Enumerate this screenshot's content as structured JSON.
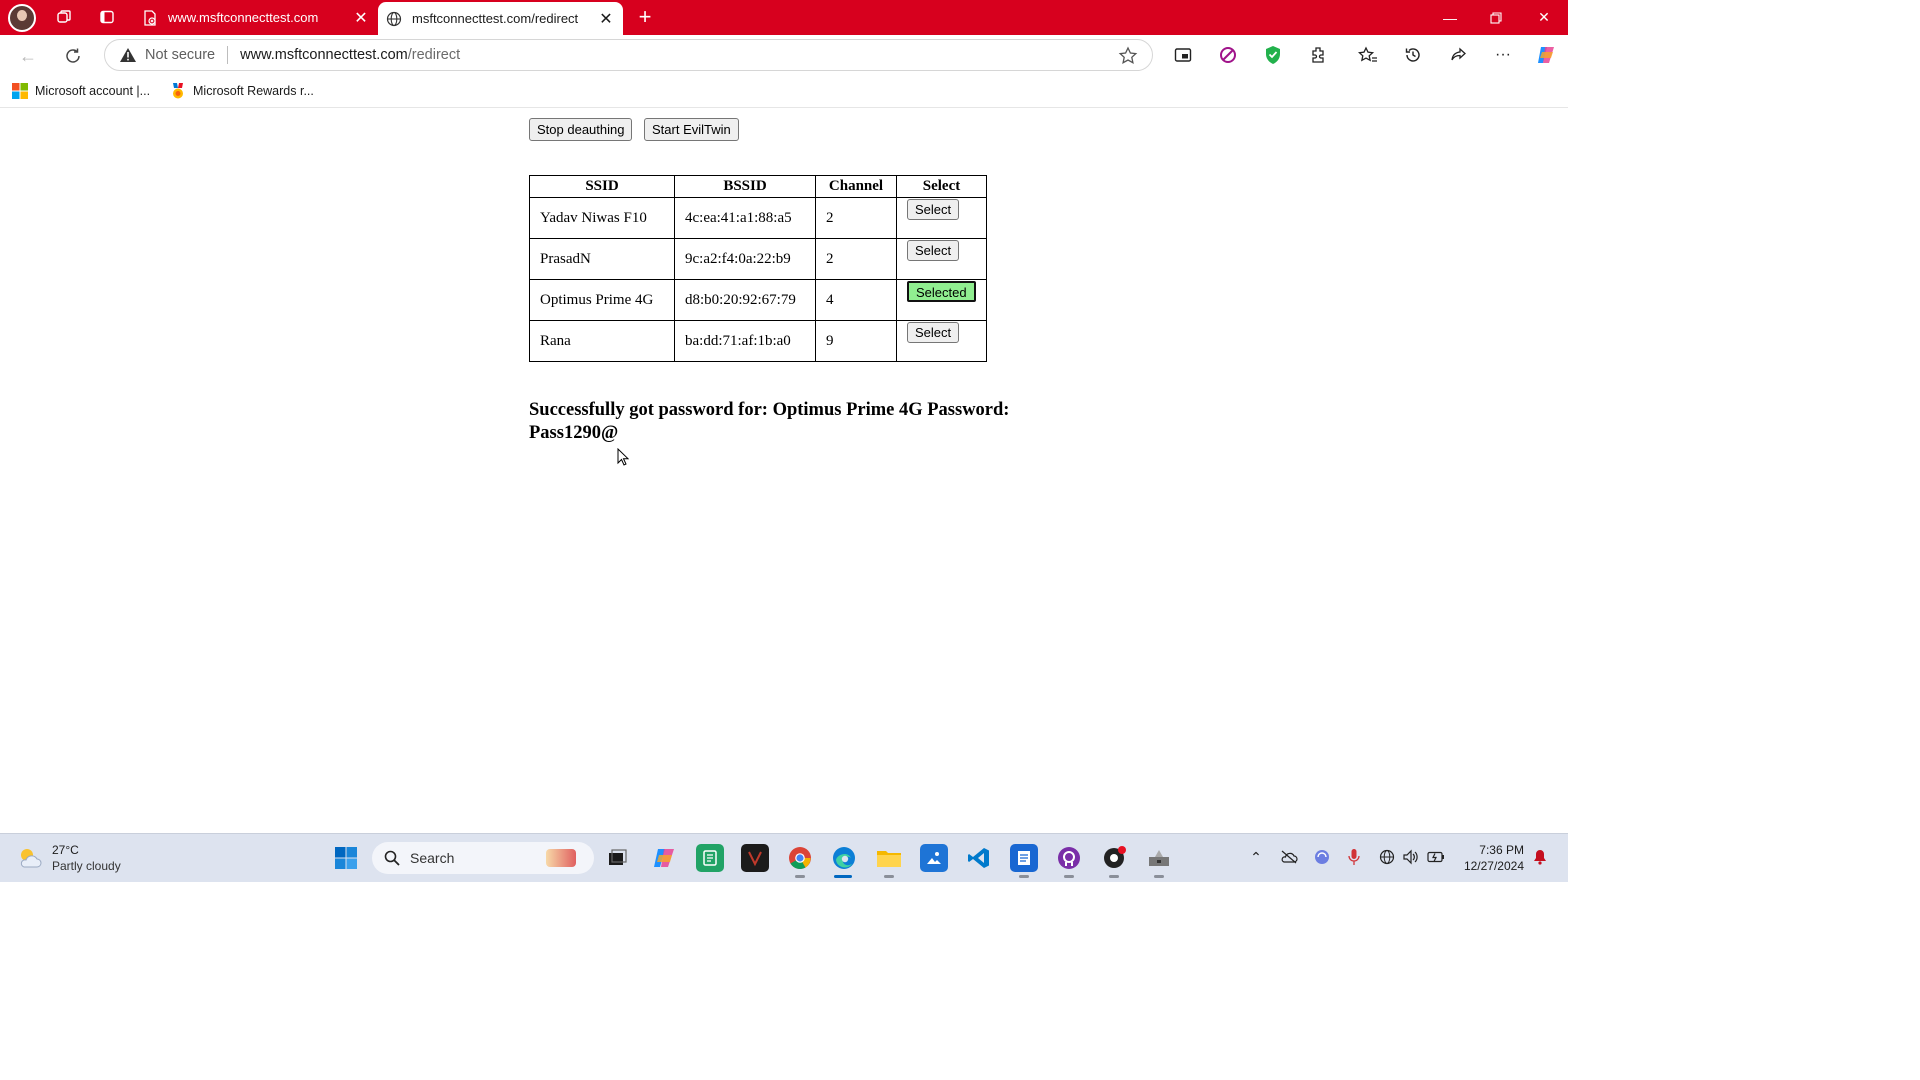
{
  "browser": {
    "tabs": [
      {
        "title": "www.msftconnecttest.com",
        "active": false
      },
      {
        "title": "msftconnecttest.com/redirect",
        "active": true
      }
    ],
    "address": {
      "security": "Not secure",
      "host": "www.msftconnecttest.com",
      "path": "/redirect"
    },
    "favorites": [
      {
        "label": "Microsoft account |..."
      },
      {
        "label": "Microsoft Rewards r..."
      }
    ]
  },
  "page": {
    "buttons": {
      "stop_deauth": "Stop deauthing",
      "start_eviltwin": "Start EvilTwin"
    },
    "table": {
      "headers": [
        "SSID",
        "BSSID",
        "Channel",
        "Select"
      ],
      "rows": [
        {
          "ssid": "Yadav Niwas F10",
          "bssid": "4c:ea:41:a1:88:a5",
          "channel": "2",
          "select": "Select",
          "selected": false
        },
        {
          "ssid": "PrasadN",
          "bssid": "9c:a2:f4:0a:22:b9",
          "channel": "2",
          "select": "Select",
          "selected": false
        },
        {
          "ssid": "Optimus Prime 4G",
          "bssid": "d8:b0:20:92:67:79",
          "channel": "4",
          "select": "Selected",
          "selected": true
        },
        {
          "ssid": "Rana",
          "bssid": "ba:dd:71:af:1b:a0",
          "channel": "9",
          "select": "Select",
          "selected": false
        }
      ]
    },
    "message": "Successfully got password for: Optimus Prime 4G Password: Pass1290@"
  },
  "taskbar": {
    "weather": {
      "temp": "27°C",
      "condition": "Partly cloudy"
    },
    "search_label": "Search",
    "clock": {
      "time": "7:36 PM",
      "date": "12/27/2024"
    }
  },
  "colors": {
    "tabstrip": "#d7001e",
    "selected_button": "#90ee90"
  }
}
